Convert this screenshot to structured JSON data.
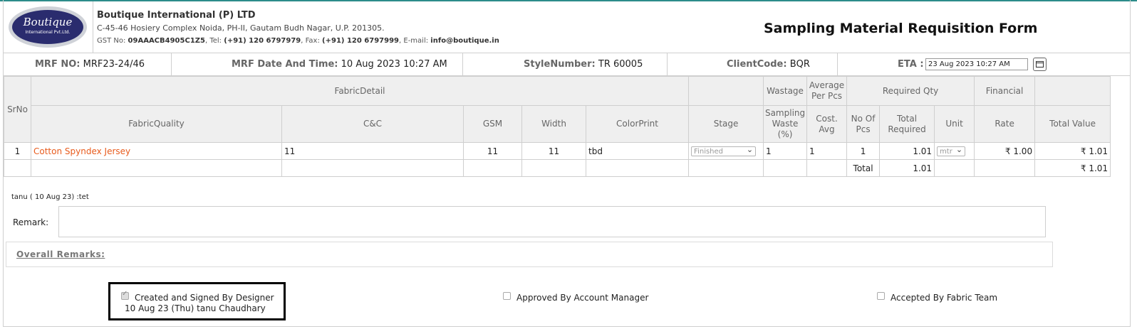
{
  "company": {
    "logo_line1": "Boutique",
    "logo_line2": "International Pvt.Ltd.",
    "name": "Boutique International (P) LTD",
    "address": "C-45-46 Hosiery Complex Noida, PH-II, Gautam Budh Nagar, U.P. 201305.",
    "gst_label": "GST No:",
    "gst_value": "09AAACB4905C1Z5",
    "tel_label": "Tel:",
    "tel_value": "(+91) 120 6797979",
    "fax_label": "Fax:",
    "fax_value": "(+91) 120 6797999",
    "email_label": "E-mail:",
    "email_value": "info@boutique.in"
  },
  "form_title": "Sampling Material Requisition Form",
  "info": {
    "mrf_no_label": "MRF NO:",
    "mrf_no": "MRF23-24/46",
    "mrf_date_label": "MRF Date And Time:",
    "mrf_date": "10 Aug 2023 10:27 AM",
    "style_label": "StyleNumber:",
    "style": "TR 60005",
    "client_label": "ClientCode:",
    "client": "BQR",
    "eta_label": "ETA :",
    "eta_value": "23 Aug 2023 10:27 AM"
  },
  "table": {
    "headers": {
      "srno": "SrNo",
      "fabric_detail": "FabricDetail",
      "wastage": "Wastage",
      "average_per_pcs": "Average Per Pcs",
      "required_qty": "Required Qty",
      "financial": "Financial",
      "fabric_quality": "FabricQuality",
      "cc": "C&C",
      "gsm": "GSM",
      "width": "Width",
      "color_print": "ColorPrint",
      "stage": "Stage",
      "sampling_waste": "Sampling Waste (%)",
      "cost_avg": "Cost. Avg",
      "no_of_pcs": "No Of Pcs",
      "total_required": "Total Required",
      "unit": "Unit",
      "rate": "Rate",
      "total_value": "Total Value"
    },
    "rows": [
      {
        "srno": "1",
        "fabric_quality": "Cotton Spyndex Jersey",
        "cc": "11",
        "gsm": "11",
        "width": "11",
        "color_print": "tbd",
        "stage": "Finished",
        "sampling_waste": "1",
        "cost_avg": "1",
        "no_of_pcs": "1",
        "total_required": "1.01",
        "unit": "mtr",
        "rate": "₹ 1.00",
        "total_value": "₹ 1.01"
      }
    ],
    "total": {
      "label": "Total",
      "total_required": "1.01",
      "total_value": "₹ 1.01"
    }
  },
  "comment_note": "tanu ( 10 Aug 23) :tet",
  "remark_label": "Remark:",
  "overall_remarks_label": "Overall Remarks:",
  "signatures": {
    "designer": {
      "label": "Created and Signed By Designer",
      "detail": "10 Aug 23 (Thu) tanu Chaudhary",
      "checked": true
    },
    "account_manager": {
      "label": "Approved By Account Manager",
      "checked": false
    },
    "fabric_team": {
      "label": "Accepted By Fabric Team",
      "checked": false
    }
  }
}
